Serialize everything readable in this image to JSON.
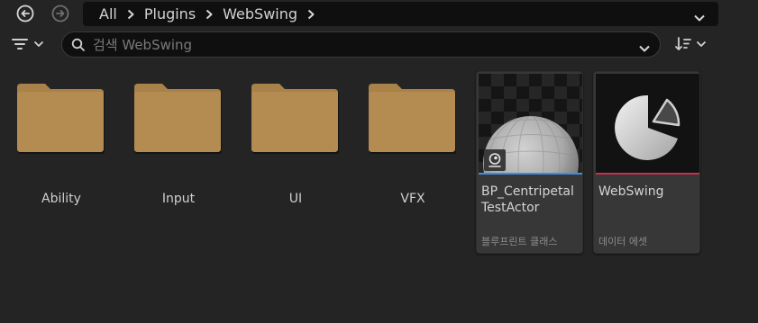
{
  "nav": {
    "back_icon": "arrow-left-circle-icon",
    "forward_icon": "arrow-right-circle-icon",
    "breadcrumbs": [
      "All",
      "Plugins",
      "WebSwing"
    ],
    "dropdown_icon": "chevron-down-icon"
  },
  "toolbar": {
    "filter_icon": "filter-icon",
    "search_placeholder": "검색 WebSwing",
    "search_value": "",
    "sort_icon": "sort-icon"
  },
  "folders": [
    {
      "label": "Ability"
    },
    {
      "label": "Input"
    },
    {
      "label": "UI"
    },
    {
      "label": "VFX"
    }
  ],
  "assets": [
    {
      "title": "BP_Centripetal\nTestActor",
      "type_label": "블루프린트 클래스",
      "type_color": "#3d8ee0",
      "badge_icon": "actor-icon"
    },
    {
      "title": "WebSwing",
      "type_label": "데이터 에셋",
      "type_color": "#c4304f"
    }
  ],
  "colors": {
    "folder": "#b08850",
    "background": "#242424",
    "bar": "#0f0f0f"
  }
}
